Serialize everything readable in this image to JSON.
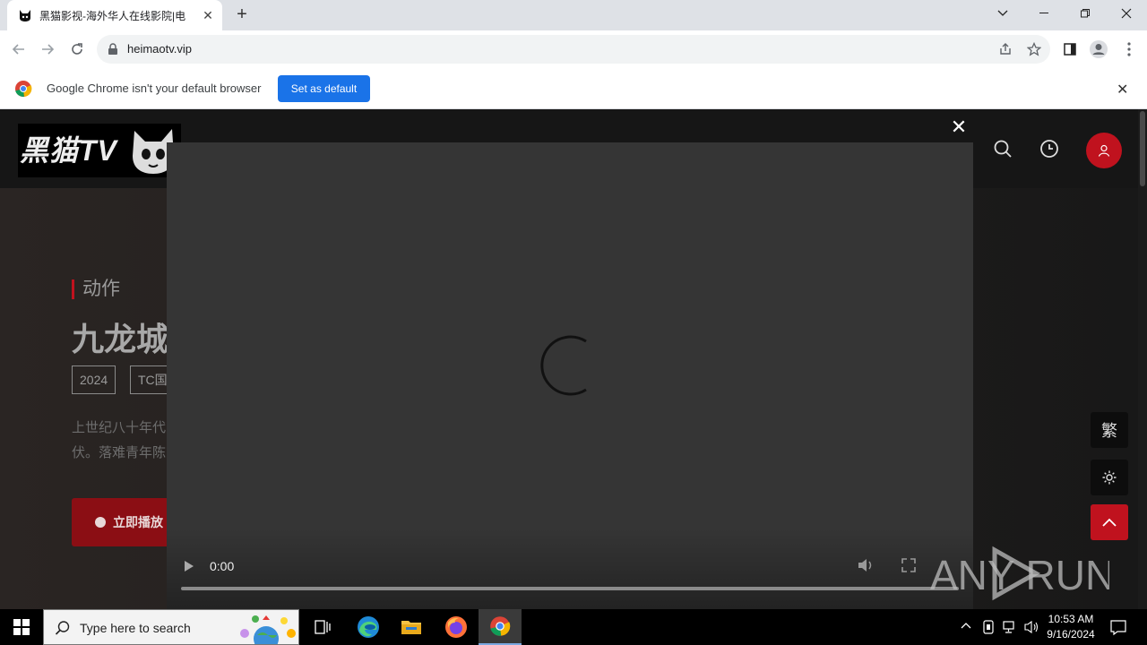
{
  "browser": {
    "tab_title": "黑猫影视-海外华人在线影院|电",
    "url": "heimaotv.vip",
    "infobar_message": "Google Chrome isn't your default browser",
    "set_default_label": "Set as default"
  },
  "site": {
    "logo_text": "黑猫TV",
    "hero": {
      "genre": "动作",
      "title": "九龙城",
      "tags": [
        "2024",
        "TC国"
      ],
      "description_lines": [
        "上世纪八十年代",
        "伏。落难青年陈"
      ],
      "play_label": "立即播放"
    },
    "side_buttons": {
      "traditional_label": "繁"
    }
  },
  "video": {
    "time": "0:00",
    "progress": 0
  },
  "watermark_text": "ANY RUN",
  "taskbar": {
    "search_placeholder": "Type here to search",
    "time": "10:53 AM",
    "date": "9/16/2024"
  },
  "colors": {
    "accent_red": "#c0121e",
    "chrome_blue": "#1a73e8"
  }
}
